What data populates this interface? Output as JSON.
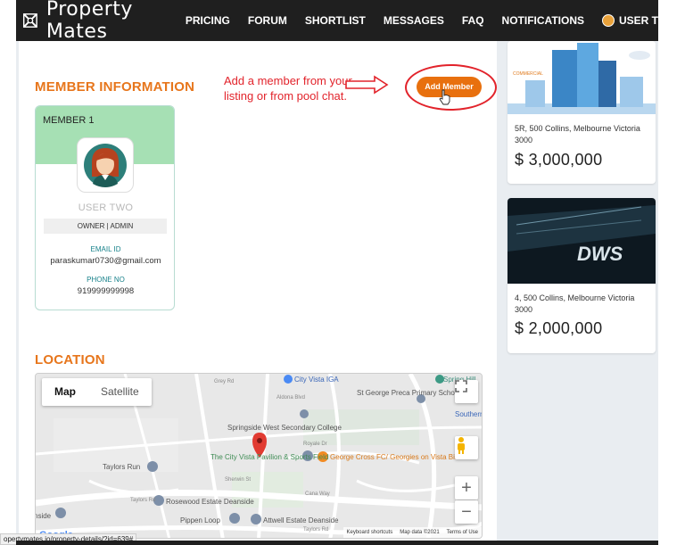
{
  "header": {
    "brand": "Property Mates",
    "nav": [
      "PRICING",
      "FORUM",
      "SHORTLIST",
      "MESSAGES",
      "FAQ",
      "NOTIFICATIONS"
    ],
    "user_label": "USER T"
  },
  "member_section": {
    "title": "MEMBER INFORMATION",
    "annotation": "Add a member from your listing or from pool chat.",
    "add_button": "Add Member",
    "card": {
      "label": "MEMBER 1",
      "name": "USER TWO",
      "role": "OWNER | ADMIN",
      "email_label": "EMAIL ID",
      "email": "paraskumar0730@gmail.com",
      "phone_label": "PHONE NO",
      "phone": "919999999998"
    }
  },
  "location_section": {
    "title": "LOCATION",
    "map": {
      "tabs": [
        "Map",
        "Satellite"
      ],
      "active_tab": "Map",
      "places": [
        "City Vista IGA",
        "St George Preca Primary School",
        "Springside West Secondary College",
        "The City Vista Pavilion & Sports Field",
        "George Cross FC/ Georgies on Vista Bistro",
        "Taylors Run",
        "Rosewood Estate Deanside",
        "Pippen Loop",
        "Attwell Estate Deanside",
        "Southern C",
        "Spring Hill"
      ],
      "streets": [
        "Taylors Rd",
        "Royale Dr",
        "Sherwin St",
        "Aldona Blvd",
        "Grey Rd",
        "Cana Way"
      ],
      "footer": [
        "Keyboard shortcuts",
        "Map data ©2021",
        "Terms of Use"
      ],
      "logo": "Google"
    }
  },
  "status_url": "opertymates.io/property-details/?id=639#",
  "sidebar": {
    "listings": [
      {
        "badge": "COMMERCIAL",
        "address": "5R, 500 Collins, Melbourne Victoria 3000",
        "price": "$ 3,000,000"
      },
      {
        "badge": "DWS",
        "address": "4, 500 Collins, Melbourne Victoria 3000",
        "price": "$ 2,000,000"
      }
    ]
  },
  "colors": {
    "accent": "#e7761c",
    "annotation": "#e2232b",
    "topbar": "#1f1f1f",
    "member_head": "#a6e0b4",
    "sidebar": "#e9edf1"
  }
}
